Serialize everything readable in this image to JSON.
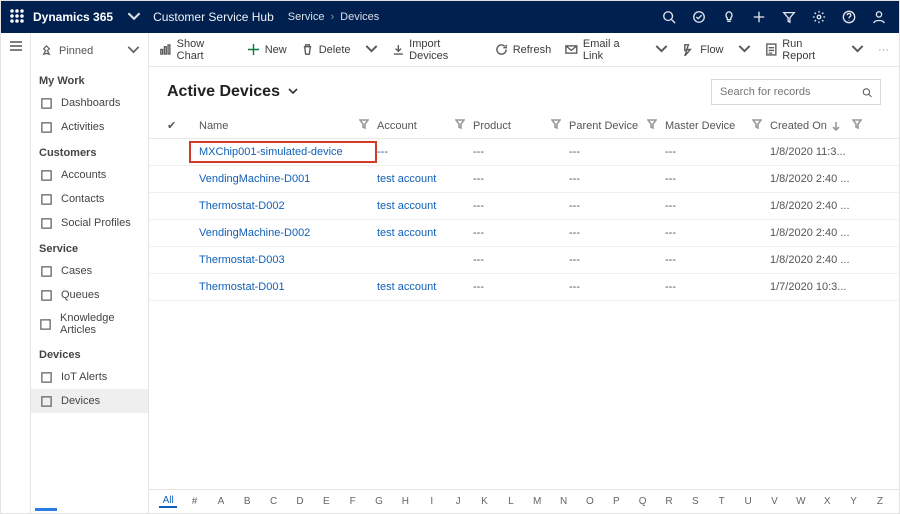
{
  "header": {
    "brand": "Dynamics 365",
    "app": "Customer Service Hub",
    "crumb1": "Service",
    "crumb2": "Devices"
  },
  "nav": {
    "pinned": "Pinned",
    "groups": [
      {
        "label": "My Work",
        "items": [
          {
            "icon": "dashboard",
            "label": "Dashboards"
          },
          {
            "icon": "activity",
            "label": "Activities"
          }
        ]
      },
      {
        "label": "Customers",
        "items": [
          {
            "icon": "account",
            "label": "Accounts"
          },
          {
            "icon": "contact",
            "label": "Contacts"
          },
          {
            "icon": "social",
            "label": "Social Profiles"
          }
        ]
      },
      {
        "label": "Service",
        "items": [
          {
            "icon": "case",
            "label": "Cases"
          },
          {
            "icon": "queue",
            "label": "Queues"
          },
          {
            "icon": "kb",
            "label": "Knowledge Articles"
          }
        ]
      },
      {
        "label": "Devices",
        "items": [
          {
            "icon": "alert",
            "label": "IoT Alerts"
          },
          {
            "icon": "device",
            "label": "Devices",
            "selected": true
          }
        ]
      }
    ]
  },
  "cmdbar": {
    "showchart": "Show Chart",
    "new": "New",
    "delete": "Delete",
    "import": "Import Devices",
    "refresh": "Refresh",
    "email": "Email a Link",
    "flow": "Flow",
    "report": "Run Report"
  },
  "view": {
    "title": "Active Devices",
    "search_placeholder": "Search for records"
  },
  "columns": {
    "name": "Name",
    "account": "Account",
    "product": "Product",
    "parent": "Parent Device",
    "master": "Master Device",
    "created": "Created On"
  },
  "rows": [
    {
      "name": "MXChip001-simulated-device",
      "account": "---",
      "product": "---",
      "parent": "---",
      "master": "---",
      "created": "1/8/2020 11:3...",
      "highlight": true
    },
    {
      "name": "VendingMachine-D001",
      "account": "test account",
      "product": "---",
      "parent": "---",
      "master": "---",
      "created": "1/8/2020 2:40 ..."
    },
    {
      "name": "Thermostat-D002",
      "account": "test account",
      "product": "---",
      "parent": "---",
      "master": "---",
      "created": "1/8/2020 2:40 ..."
    },
    {
      "name": "VendingMachine-D002",
      "account": "test account",
      "product": "---",
      "parent": "---",
      "master": "---",
      "created": "1/8/2020 2:40 ..."
    },
    {
      "name": "Thermostat-D003",
      "account": "",
      "product": "---",
      "parent": "---",
      "master": "---",
      "created": "1/8/2020 2:40 ..."
    },
    {
      "name": "Thermostat-D001",
      "account": "test account",
      "product": "---",
      "parent": "---",
      "master": "---",
      "created": "1/7/2020 10:3..."
    }
  ],
  "alpha": [
    "All",
    "#",
    "A",
    "B",
    "C",
    "D",
    "E",
    "F",
    "G",
    "H",
    "I",
    "J",
    "K",
    "L",
    "M",
    "N",
    "O",
    "P",
    "Q",
    "R",
    "S",
    "T",
    "U",
    "V",
    "W",
    "X",
    "Y",
    "Z"
  ]
}
